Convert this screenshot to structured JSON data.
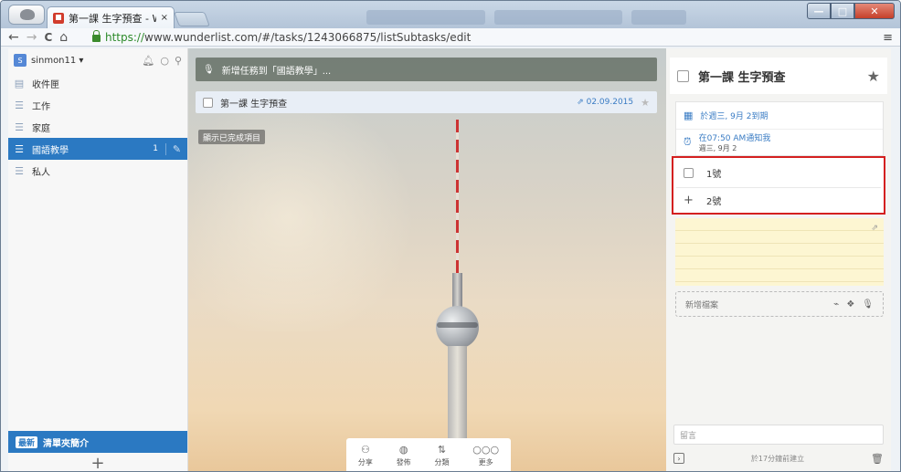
{
  "browser": {
    "tab_title": "第一課 生字預查 - W",
    "tab_close": "×",
    "url_scheme": "https://",
    "url_rest": "www.wunderlist.com/#/tasks/1243066875/listSubtasks/edit",
    "back": "←",
    "forward": "→",
    "reload": "C",
    "home": "⌂",
    "menu": "≡",
    "min": "—",
    "max": "□",
    "close": "✕"
  },
  "sidebar": {
    "avatar_letter": "S",
    "username": "sinmon11 ▾",
    "icons": [
      "bell-icon",
      "chat-icon",
      "search-icon"
    ],
    "items": [
      {
        "icon": "inbox-icon",
        "label": "收件匣",
        "count": "",
        "active": false
      },
      {
        "icon": "list-icon",
        "label": "工作",
        "count": "",
        "active": false
      },
      {
        "icon": "list-icon",
        "label": "家庭",
        "count": "",
        "active": false
      },
      {
        "icon": "list-icon",
        "label": "國語教學",
        "count": "1",
        "active": true
      },
      {
        "icon": "list-icon",
        "label": "私人",
        "count": "",
        "active": false
      }
    ],
    "bottom_badge": "最新",
    "bottom_label": "清單夾簡介",
    "add": "+"
  },
  "main": {
    "add_task_placeholder": "新增任務到「國語教學」...",
    "task": {
      "title": "第一課 生字預查",
      "date": "02.09.2015",
      "star": "★"
    },
    "show_completed": "顯示已完成項目",
    "toolbar": [
      {
        "icon": "share-icon",
        "label": "分享"
      },
      {
        "icon": "publish-icon",
        "label": "發佈"
      },
      {
        "icon": "sort-icon",
        "label": "分類"
      },
      {
        "icon": "more-icon",
        "label": "更多"
      }
    ]
  },
  "detail": {
    "title": "第一課 生字預查",
    "star": "★",
    "due": "於週三, 9月 2到期",
    "reminder": "在07:50 AM通知我",
    "reminder_sub": "週三, 9月 2",
    "subtasks": [
      "1號"
    ],
    "new_subtask_value": "2號",
    "add_file": "新增檔案",
    "comment_placeholder": "留言",
    "created": "於17分鐘前建立"
  }
}
